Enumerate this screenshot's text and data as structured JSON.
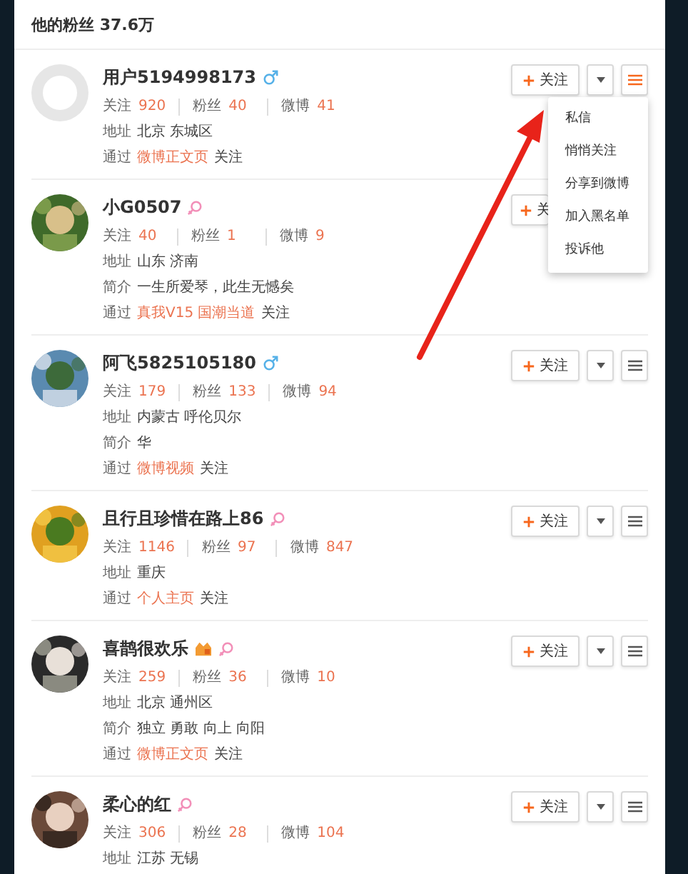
{
  "header": {
    "title": "他的粉丝",
    "count": "37.6万"
  },
  "users": [
    {
      "name": "用户5194998173",
      "gender": {
        "kind": "male"
      },
      "badge": false,
      "avatar": {
        "kind": "placeholder"
      },
      "stats": [
        {
          "label": "关注",
          "value": "920"
        },
        {
          "label": "粉丝",
          "value": "40"
        },
        {
          "label": "微博",
          "value": "41"
        }
      ],
      "info": [
        {
          "label": "地址",
          "value": "北京 东城区"
        }
      ],
      "via": {
        "prefix": "通过",
        "link": "微博正文页",
        "suffix": "关注"
      },
      "follow": "关注",
      "controls_covered": false,
      "menu_open": true
    },
    {
      "name": "小G0507",
      "gender": {
        "kind": "female"
      },
      "badge": false,
      "avatar": {
        "kind": "picture"
      },
      "stats": [
        {
          "label": "关注",
          "value": "40"
        },
        {
          "label": "粉丝",
          "value": "1"
        },
        {
          "label": "微博",
          "value": "9"
        }
      ],
      "info": [
        {
          "label": "地址",
          "value": "山东 济南"
        },
        {
          "label": "简介",
          "value": "一生所爱琴，此生无憾矣"
        }
      ],
      "via": {
        "prefix": "通过",
        "link": "真我V15 国潮当道",
        "suffix": "关注"
      },
      "follow": "关",
      "controls_covered": true,
      "menu_open": false
    },
    {
      "name": "阿飞5825105180",
      "gender": {
        "kind": "male"
      },
      "badge": false,
      "avatar": {
        "kind": "picture"
      },
      "stats": [
        {
          "label": "关注",
          "value": "179"
        },
        {
          "label": "粉丝",
          "value": "133"
        },
        {
          "label": "微博",
          "value": "94"
        }
      ],
      "info": [
        {
          "label": "地址",
          "value": "内蒙古 呼伦贝尔"
        },
        {
          "label": "简介",
          "value": "华"
        }
      ],
      "via": {
        "prefix": "通过",
        "link": "微博视频",
        "suffix": "关注"
      },
      "follow": "关注",
      "controls_covered": false,
      "menu_open": false
    },
    {
      "name": "且行且珍惜在路上86",
      "gender": {
        "kind": "female"
      },
      "badge": false,
      "avatar": {
        "kind": "picture"
      },
      "stats": [
        {
          "label": "关注",
          "value": "1146"
        },
        {
          "label": "粉丝",
          "value": "97"
        },
        {
          "label": "微博",
          "value": "847"
        }
      ],
      "info": [
        {
          "label": "地址",
          "value": "重庆"
        }
      ],
      "via": {
        "prefix": "通过",
        "link": "个人主页",
        "suffix": "关注"
      },
      "follow": "关注",
      "controls_covered": false,
      "menu_open": false
    },
    {
      "name": "喜鹊很欢乐",
      "gender": {
        "kind": "female"
      },
      "badge": true,
      "avatar": {
        "kind": "picture"
      },
      "stats": [
        {
          "label": "关注",
          "value": "259"
        },
        {
          "label": "粉丝",
          "value": "36"
        },
        {
          "label": "微博",
          "value": "10"
        }
      ],
      "info": [
        {
          "label": "地址",
          "value": "北京 通州区"
        },
        {
          "label": "简介",
          "value": "独立 勇敢 向上 向阳"
        }
      ],
      "via": {
        "prefix": "通过",
        "link": "微博正文页",
        "suffix": "关注"
      },
      "follow": "关注",
      "controls_covered": false,
      "menu_open": false
    },
    {
      "name": "柔心的红",
      "gender": {
        "kind": "female"
      },
      "badge": false,
      "avatar": {
        "kind": "picture"
      },
      "stats": [
        {
          "label": "关注",
          "value": "306"
        },
        {
          "label": "粉丝",
          "value": "28"
        },
        {
          "label": "微博",
          "value": "104"
        }
      ],
      "info": [
        {
          "label": "地址",
          "value": "江苏 无锡"
        }
      ],
      "follow": "关注",
      "controls_covered": false,
      "menu_open": false
    }
  ],
  "menu": {
    "items": [
      "私信",
      "悄悄关注",
      "分享到微博",
      "加入黑名单",
      "投诉他"
    ]
  }
}
